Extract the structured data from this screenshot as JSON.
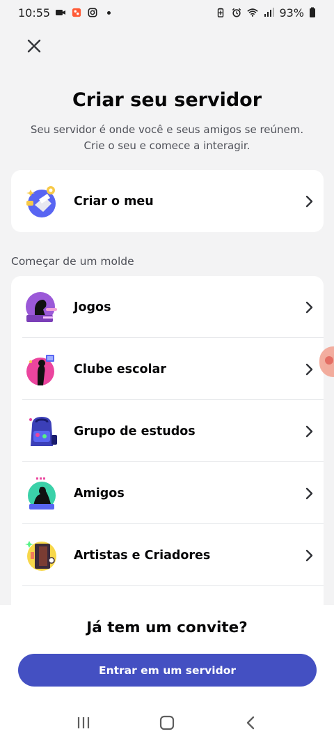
{
  "status_bar": {
    "time": "10:55",
    "battery": "93%",
    "left_icons": [
      "video-icon",
      "notification-app-icon",
      "instagram-icon",
      "dot-icon"
    ],
    "right_icons": [
      "battery-saver-icon",
      "alarm-icon",
      "wifi-icon",
      "signal-icon",
      "battery-icon"
    ]
  },
  "header": {
    "close_icon": "close-icon",
    "title": "Criar seu servidor",
    "subtitle": "Seu servidor é onde você e seus amigos se reúnem. Crie o seu e comece a interagir."
  },
  "create_own": {
    "label": "Criar o meu",
    "icon": "create-server-icon"
  },
  "templates": {
    "section_label": "Começar de um molde",
    "items": [
      {
        "label": "Jogos",
        "icon": "gaming-icon"
      },
      {
        "label": "Clube escolar",
        "icon": "school-club-icon"
      },
      {
        "label": "Grupo de estudos",
        "icon": "study-group-icon"
      },
      {
        "label": "Amigos",
        "icon": "friends-icon"
      },
      {
        "label": "Artistas e Criadores",
        "icon": "artists-icon"
      }
    ]
  },
  "invite": {
    "question": "Já tem um convite?",
    "join_button": "Entrar em um servidor"
  },
  "colors": {
    "accent": "#4450c2",
    "background": "#f3f3f4",
    "card": "#ffffff"
  }
}
